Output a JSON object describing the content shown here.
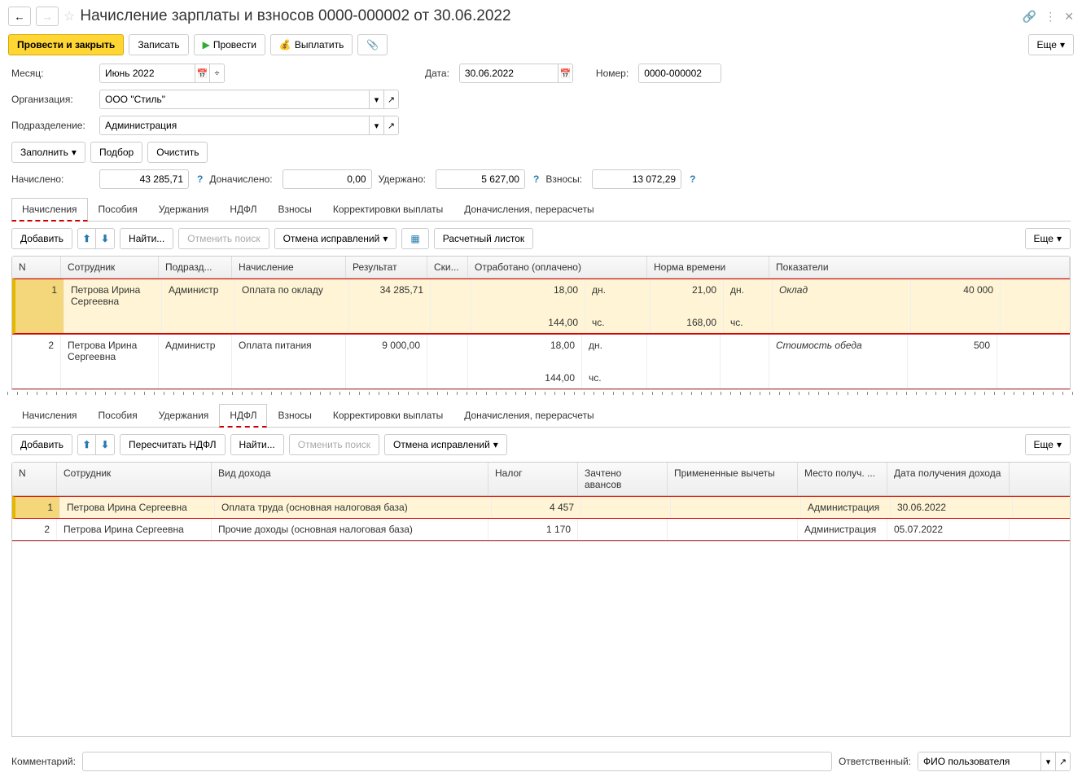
{
  "header": {
    "title": "Начисление зарплаты и взносов 0000-000002 от 30.06.2022"
  },
  "toolbar": {
    "post_close": "Провести и закрыть",
    "save": "Записать",
    "post": "Провести",
    "pay": "Выплатить",
    "more": "Еще"
  },
  "form": {
    "month_label": "Месяц:",
    "month": "Июнь 2022",
    "date_label": "Дата:",
    "date": "30.06.2022",
    "number_label": "Номер:",
    "number": "0000-000002",
    "org_label": "Организация:",
    "org": "ООО \"Стиль\"",
    "dept_label": "Подразделение:",
    "dept": "Администрация",
    "fill": "Заполнить",
    "pick": "Подбор",
    "clear": "Очистить",
    "accrued_label": "Начислено:",
    "accrued": "43 285,71",
    "add_accrued_label": "Доначислено:",
    "add_accrued": "0,00",
    "withheld_label": "Удержано:",
    "withheld": "5 627,00",
    "contrib_label": "Взносы:",
    "contrib": "13 072,29"
  },
  "tabs": [
    "Начисления",
    "Пособия",
    "Удержания",
    "НДФЛ",
    "Взносы",
    "Корректировки выплаты",
    "Доначисления, перерасчеты"
  ],
  "panel1": {
    "toolbar": {
      "add": "Добавить",
      "find": "Найти...",
      "cancel_search": "Отменить поиск",
      "cancel_fix": "Отмена исправлений",
      "paysheet": "Расчетный листок",
      "more": "Еще"
    },
    "cols": {
      "n": "N",
      "emp": "Сотрудник",
      "dep": "Подразд...",
      "acc": "Начисление",
      "res": "Результат",
      "sk": "Ски...",
      "wrk": "Отработано (оплачено)",
      "nrm": "Норма времени",
      "ind": "Показатели"
    },
    "rows": [
      {
        "n": "1",
        "emp": "Петрова Ирина Сергеевна",
        "dep": "Администр",
        "acc": "Оплата по окладу",
        "res": "34 285,71",
        "wrk_d": "18,00",
        "wrk_du": "дн.",
        "wrk_h": "144,00",
        "wrk_hu": "чс.",
        "nrm_d": "21,00",
        "nrm_du": "дн.",
        "nrm_h": "168,00",
        "nrm_hu": "чс.",
        "ind": "Оклад",
        "ind_v": "40 000"
      },
      {
        "n": "2",
        "emp": "Петрова Ирина Сергеевна",
        "dep": "Администр",
        "acc": "Оплата питания",
        "res": "9 000,00",
        "wrk_d": "18,00",
        "wrk_du": "дн.",
        "wrk_h": "144,00",
        "wrk_hu": "чс.",
        "ind": "Стоимость обеда",
        "ind_v": "500"
      }
    ]
  },
  "panel2": {
    "toolbar": {
      "add": "Добавить",
      "recalc": "Пересчитать НДФЛ",
      "find": "Найти...",
      "cancel_search": "Отменить поиск",
      "cancel_fix": "Отмена исправлений",
      "more": "Еще"
    },
    "cols": {
      "n": "N",
      "emp": "Сотрудник",
      "typ": "Вид дохода",
      "tax": "Налог",
      "adv": "Зачтено авансов",
      "ded": "Примененные вычеты",
      "pl": "Место получ. ...",
      "dt": "Дата получения дохода"
    },
    "rows": [
      {
        "n": "1",
        "emp": "Петрова Ирина Сергеевна",
        "typ": "Оплата труда (основная налоговая база)",
        "tax": "4 457",
        "pl": "Администрация",
        "dt": "30.06.2022"
      },
      {
        "n": "2",
        "emp": "Петрова Ирина Сергеевна",
        "typ": "Прочие доходы (основная налоговая база)",
        "tax": "1 170",
        "pl": "Администрация",
        "dt": "05.07.2022"
      }
    ]
  },
  "footer": {
    "comment_label": "Комментарий:",
    "resp_label": "Ответственный:",
    "resp": "ФИО пользователя"
  }
}
